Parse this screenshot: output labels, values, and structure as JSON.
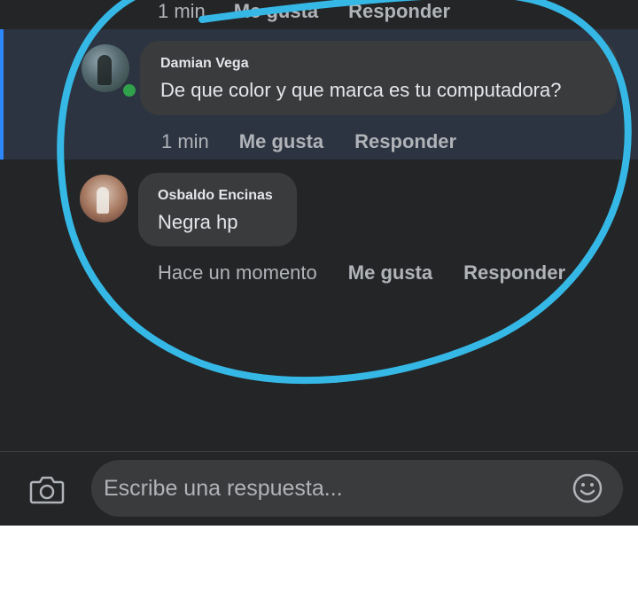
{
  "top_comment": {
    "time": "1 min",
    "like_label": "Me gusta",
    "reply_label": "Responder"
  },
  "comments": [
    {
      "author": "Damian Vega",
      "text": "De que color y que marca es tu computadora?",
      "time": "1 min",
      "like_label": "Me gusta",
      "reply_label": "Responder",
      "online": true
    },
    {
      "author": "Osbaldo Encinas",
      "text": "Negra hp",
      "time": "Hace un momento",
      "like_label": "Me gusta",
      "reply_label": "Responder"
    }
  ],
  "composer": {
    "placeholder": "Escribe una respuesta...",
    "camera_icon": "camera-icon",
    "emoji_icon": "emoji-icon"
  },
  "colors": {
    "background": "#242526",
    "highlight": "#2b3440",
    "bubble": "#3a3b3c",
    "online": "#31a24c",
    "annotation": "#35b8e6"
  }
}
